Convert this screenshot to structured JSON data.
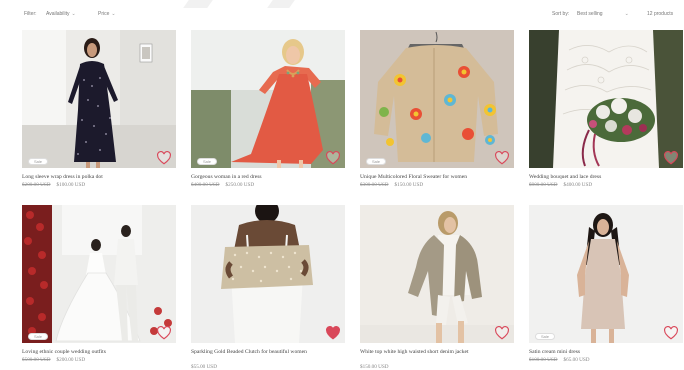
{
  "toolbar": {
    "filter_label": "Filter:",
    "availability_label": "Availability",
    "price_label": "Price",
    "sort_label": "Sort by:",
    "sort_value": "Best selling",
    "product_count": "12 products"
  },
  "colors": {
    "heart": "#d9485a",
    "badge_text": "#999999",
    "title_text": "#444444",
    "price_text": "#888888"
  },
  "products": [
    {
      "title": "Long sleeve wrap dress in polka dot",
      "old_price": "$200.00 USD",
      "price": "$100.00 USD",
      "badge": "Sale",
      "heart_filled": false,
      "icon": "heart-outline-icon"
    },
    {
      "title": "Gorgeous woman in a red dress",
      "old_price": "$400.00 USD",
      "price": "$250.00 USD",
      "badge": "Sale",
      "heart_filled": false,
      "icon": "heart-outline-icon"
    },
    {
      "title": "Unique Multicolored Floral Sweater for women",
      "old_price": "$300.00 USD",
      "price": "$150.00 USD",
      "badge": "Sale",
      "heart_filled": false,
      "icon": "heart-outline-icon"
    },
    {
      "title": "Wedding bouquet and lace dress",
      "old_price": "$900.00 USD",
      "price": "$400.00 USD",
      "badge": "",
      "heart_filled": false,
      "icon": "heart-outline-icon"
    },
    {
      "title": "Loving ethnic couple wedding outfits",
      "old_price": "$500.00 USD",
      "price": "$200.00 USD",
      "badge": "Sale",
      "heart_filled": false,
      "icon": "heart-outline-icon"
    },
    {
      "title": "Sparkling Gold Beaded Clutch for beautiful women",
      "old_price": "",
      "price": "$55.00 USD",
      "badge": "",
      "heart_filled": true,
      "icon": "heart-filled-icon"
    },
    {
      "title": "White top white high waisted short denim jacket",
      "old_price": "",
      "price": "$150.00 USD",
      "badge": "",
      "heart_filled": false,
      "icon": "heart-outline-icon"
    },
    {
      "title": "Satin cream mini dress",
      "old_price": "$100.00 USD",
      "price": "$65.00 USD",
      "badge": "Sale",
      "heart_filled": false,
      "icon": "heart-outline-icon"
    }
  ]
}
